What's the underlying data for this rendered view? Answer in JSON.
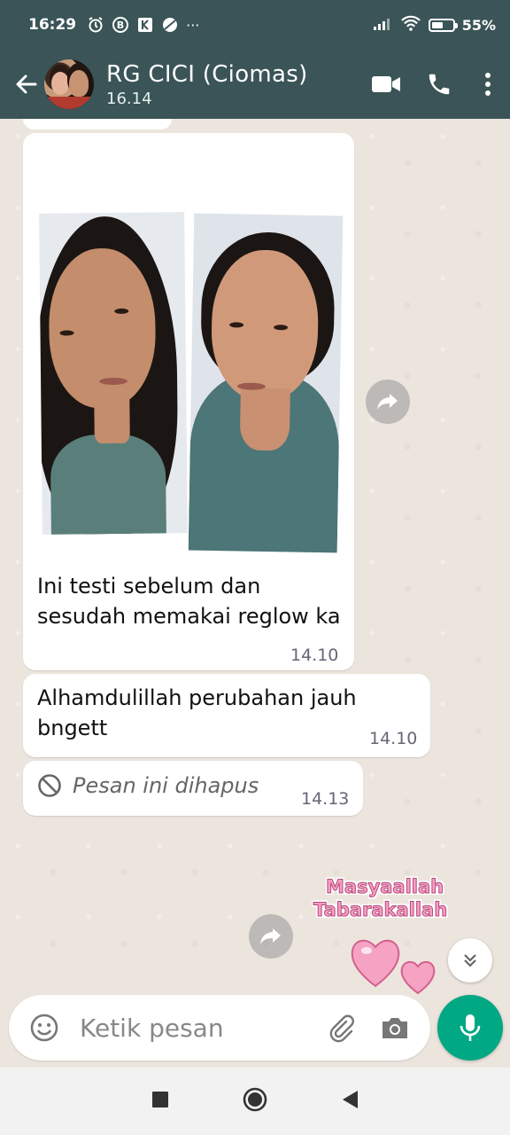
{
  "status_bar": {
    "time": "16:29",
    "more": "···",
    "battery_text": "55%",
    "battery_level": 0.55
  },
  "header": {
    "contact_name": "RG CICI (Ciomas)",
    "last_seen": "16.14"
  },
  "messages": [
    {
      "type": "image",
      "text": "Ini testi sebelum dan sesudah memakai reglow ka",
      "time": "14.10"
    },
    {
      "type": "text",
      "text": "Alhamdulillah perubahan jauh bngett",
      "time": "14.10"
    },
    {
      "type": "deleted",
      "text": "Pesan ini dihapus",
      "time": "14.13"
    }
  ],
  "sticker": {
    "line1": "Masyaallah",
    "line2": "Tabarakallah"
  },
  "composer": {
    "placeholder": "Ketik pesan"
  },
  "colors": {
    "header": "#3a5457",
    "chat_bg": "#ece5dd",
    "mic": "#00a884"
  }
}
